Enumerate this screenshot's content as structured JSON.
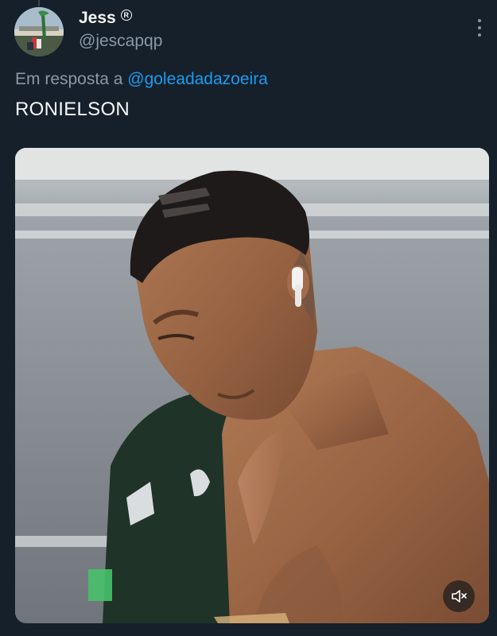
{
  "author": {
    "display_name": "Jess",
    "badge_icon": "registered-icon",
    "handle": "@jescapqp"
  },
  "reply": {
    "prefix": "Em resposta a",
    "mention": "@goleadadazoeira"
  },
  "tweet": {
    "text": "RONIELSON"
  },
  "media": {
    "type": "video",
    "muted_icon": "volume-muted-icon"
  },
  "colors": {
    "background": "#15202b",
    "primary_text": "#f7f9f9",
    "secondary_text": "#8b98a5",
    "link": "#1d9bf0"
  }
}
